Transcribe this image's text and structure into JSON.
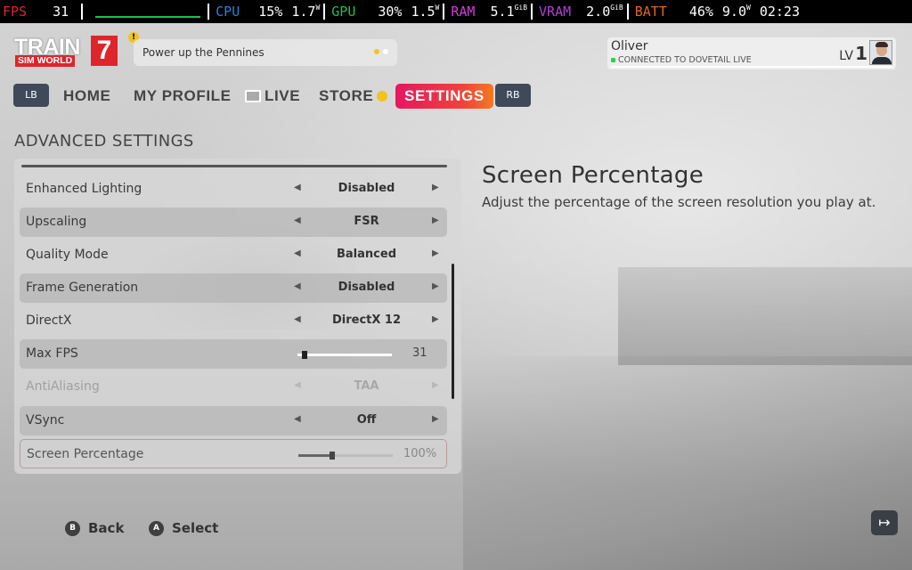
{
  "perf": {
    "fps_label": "FPS",
    "fps_value": "31",
    "cpu_label": "CPU",
    "cpu_usage": "15%",
    "cpu_power": "1.7",
    "cpu_power_unit": "W",
    "gpu_label": "GPU",
    "gpu_usage": "30%",
    "gpu_power": "1.5",
    "gpu_power_unit": "W",
    "ram_label": "RAM",
    "ram_value": "5.1",
    "ram_unit": "GiB",
    "vram_label": "VRAM",
    "vram_value": "2.0",
    "vram_unit": "GiB",
    "batt_label": "BATT",
    "batt_percent": "46%",
    "batt_power": "9.0",
    "batt_power_unit": "W",
    "clock": "02:23",
    "colors": {
      "fps": "#e0242b",
      "cpu": "#2f7fd6",
      "gpu": "#19c24a",
      "ram": "#d43ad9",
      "vram": "#b23ed6",
      "batt": "#e0661b"
    }
  },
  "header": {
    "logo_word": "TRAIN",
    "logo_sub": "SIM WORLD",
    "logo_number": "7",
    "alert_icon": "!",
    "news_text": "Power up the Pennines"
  },
  "profile": {
    "name": "Oliver",
    "status": "CONNECTED TO DOVETAIL LIVE",
    "level_label": "LV",
    "level_value": "1"
  },
  "tabs": {
    "lb": "LB",
    "rb": "RB",
    "items": [
      {
        "label": "HOME"
      },
      {
        "label": "MY PROFILE"
      },
      {
        "label": "LIVE"
      },
      {
        "label": "STORE"
      },
      {
        "label": "SETTINGS"
      }
    ],
    "active": "SETTINGS"
  },
  "section_title": "ADVANCED SETTINGS",
  "settings": [
    {
      "label": "Enhanced Lighting",
      "value": "Disabled"
    },
    {
      "label": "Upscaling",
      "value": "FSR"
    },
    {
      "label": "Quality Mode",
      "value": "Balanced"
    },
    {
      "label": "Frame Generation",
      "value": "Disabled"
    },
    {
      "label": "DirectX",
      "value": "DirectX 12"
    },
    {
      "label": "Max FPS",
      "value": "31",
      "slider_fraction": 0.05
    },
    {
      "label": "AntiAliasing",
      "value": "TAA",
      "disabled": true
    },
    {
      "label": "VSync",
      "value": "Off"
    },
    {
      "label": "Screen Percentage",
      "value": "100%",
      "slider_fraction": 0.33
    }
  ],
  "description": {
    "title": "Screen Percentage",
    "text": "Adjust the percentage of the screen resolution you play at."
  },
  "footer": {
    "back_glyph": "B",
    "back_label": "Back",
    "select_glyph": "A",
    "select_label": "Select",
    "exit_icon": "↦"
  }
}
